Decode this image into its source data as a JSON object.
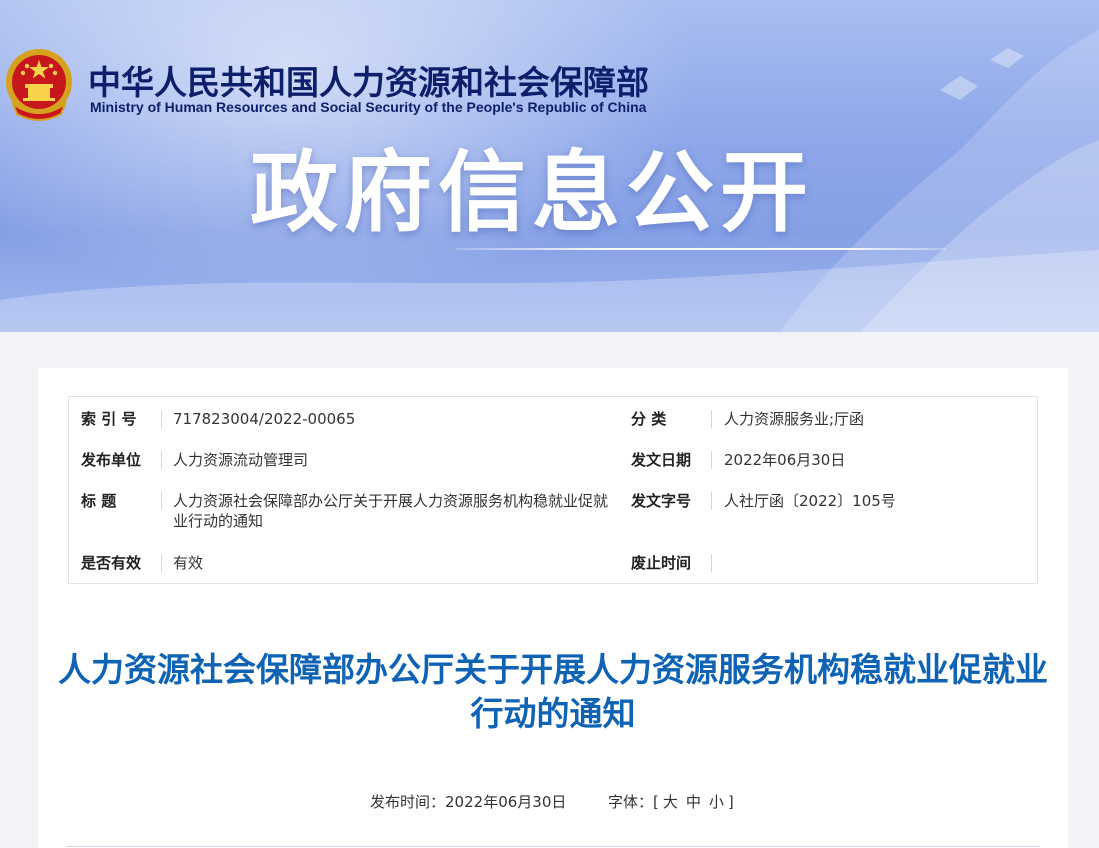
{
  "header": {
    "ministry_cn": "中华人民共和国人力资源和社会保障部",
    "ministry_en": "Ministry of Human Resources and Social Security of the People's Republic of China",
    "banner_title": "政府信息公开"
  },
  "info": {
    "index_label": "索  引  号",
    "index_value": "717823004/2022-00065",
    "category_label": "分      类",
    "category_value": "人力资源服务业;厅函",
    "publisher_label": "发布单位",
    "publisher_value": "人力资源流动管理司",
    "issue_date_label": "发文日期",
    "issue_date_value": "2022年06月30日",
    "title_label": "标      题",
    "title_value": "人力资源社会保障部办公厅关于开展人力资源服务机构稳就业促就业行动的通知",
    "doc_number_label": "发文字号",
    "doc_number_value": "人社厅函〔2022〕105号",
    "valid_label": "是否有效",
    "valid_value": "有效",
    "repeal_label": "废止时间",
    "repeal_value": ""
  },
  "article": {
    "title": "人力资源社会保障部办公厅关于开展人力资源服务机构稳就业促就业行动的通知",
    "publish_prefix": "发布时间：",
    "publish_date": "2022年06月30日",
    "font_label": "字体：",
    "bracket_open": "[",
    "font_large": "大",
    "font_medium": "中",
    "font_small": "小",
    "bracket_close": "]"
  },
  "colors": {
    "title_blue": "#0f63b5",
    "ministry_navy": "#0d1f6b",
    "banner_blue": "#8fa8ea"
  }
}
